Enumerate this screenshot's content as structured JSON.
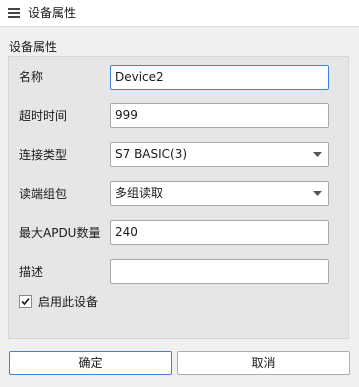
{
  "window": {
    "title": "设备属性",
    "icon": "list-icon"
  },
  "group": {
    "title": "设备属性"
  },
  "fields": {
    "name": {
      "label": "名称",
      "value": "Device2"
    },
    "timeout": {
      "label": "超时时间",
      "value": "999"
    },
    "connection_type": {
      "label": "连接类型",
      "value": "S7 BASIC(3)"
    },
    "read_packing": {
      "label": "读端组包",
      "value": "多组读取"
    },
    "max_apdu": {
      "label": "最大APDU数量",
      "value": "240"
    },
    "description": {
      "label": "描述",
      "value": ""
    }
  },
  "enable_device": {
    "label": "启用此设备",
    "checked": true
  },
  "buttons": {
    "ok": "确定",
    "cancel": "取消"
  },
  "colors": {
    "accent": "#3c82d8",
    "background": "#f0f0f0",
    "group_bg": "#e6e6e6"
  }
}
